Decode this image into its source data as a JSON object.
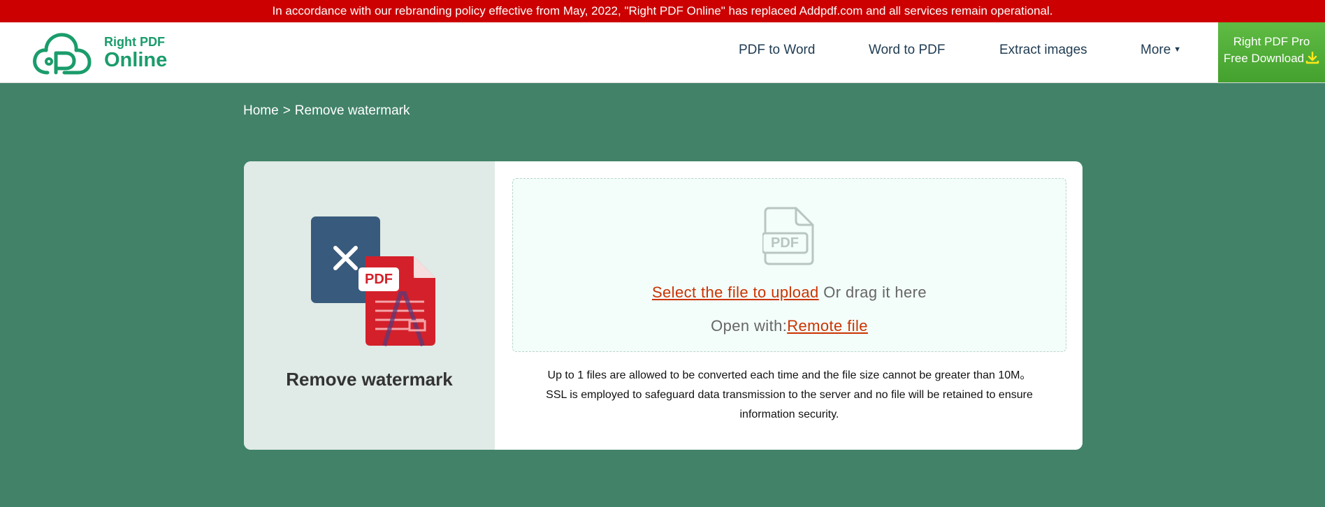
{
  "banner": {
    "text": "In accordance with our rebranding policy effective from May, 2022, \"Right PDF Online\" has replaced Addpdf.com and all services remain operational."
  },
  "logo": {
    "line1": "Right PDF",
    "line2": "Online",
    "icon": "cloud-p-logo-icon"
  },
  "nav": {
    "items": [
      {
        "label": "PDF to Word"
      },
      {
        "label": "Word to PDF"
      },
      {
        "label": "Extract images"
      },
      {
        "label": "More"
      }
    ],
    "more_icon": "caret-down-icon"
  },
  "pro_button": {
    "line1": "Right PDF Pro",
    "line2": "Free Download",
    "icon": "download-icon"
  },
  "breadcrumb": {
    "home": "Home",
    "separator": ">",
    "current": "Remove watermark"
  },
  "tool": {
    "title": "Remove watermark",
    "illustration": "remove-watermark-illustration",
    "badge": "PDF"
  },
  "upload": {
    "pdf_icon_label": "PDF",
    "select_link": "Select the file to upload",
    "drag_text": "Or drag it here",
    "open_with_label": "Open with:",
    "remote_link": "Remote file"
  },
  "info": {
    "line1": "Up to 1 files are allowed to be converted each time and the file size cannot be greater than 10M。",
    "line2": "SSL is employed to safeguard data transmission to the server and no file will be retained to ensure",
    "line3": "information security."
  },
  "colors": {
    "background": "#418269",
    "banner": "#cc0000",
    "brand": "#1a9c6b",
    "link": "#cc3300",
    "pro_button": "#52b03a",
    "nav_text": "#1f3b52"
  }
}
